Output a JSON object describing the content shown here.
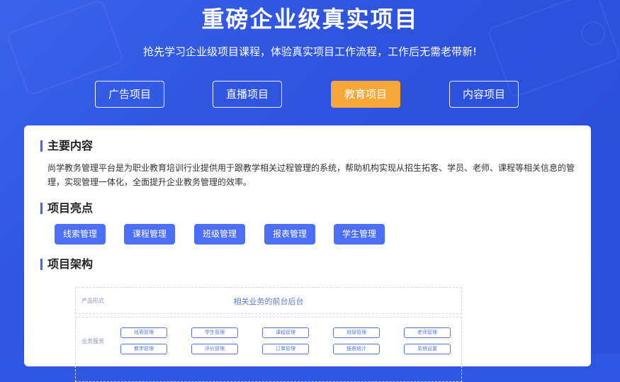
{
  "hero": {
    "title": "重磅企业级真实项目",
    "subtitle": "抢先学习企业级项目课程，体验真实项目工作流程，工作后无需老带新!"
  },
  "tabs": [
    {
      "label": "广告项目",
      "active": false
    },
    {
      "label": "直播项目",
      "active": false
    },
    {
      "label": "教育项目",
      "active": true
    },
    {
      "label": "内容项目",
      "active": false
    }
  ],
  "content": {
    "main_title": "主要内容",
    "main_desc": "尚学教务管理平台是为职业教育培训行业提供用于跟教学相关过程管理的系统，帮助机构实现从招生拓客、学员、老师、课程等相关信息的管理，实现管理一体化，全面提升企业教务管理的效率。",
    "highlights_title": "项目亮点",
    "highlights": [
      "线索管理",
      "课程管理",
      "班级管理",
      "报表管理",
      "学生管理"
    ],
    "architecture_title": "项目架构"
  },
  "architecture": {
    "row1_label": "产品形式",
    "row1_head": "相关业务的前台后台",
    "row2_label": "业务服务",
    "boxes_top": [
      "线索管理",
      "学生管理",
      "课程管理",
      "班级管理",
      "老师管理"
    ],
    "boxes_bottom": [
      "教学管理",
      "评价管理",
      "订单管理",
      "报表统计",
      "系统设置"
    ]
  },
  "colors": {
    "background": "#2f56e0",
    "active_tab": "#f7a738",
    "pill": "#4c6ef5",
    "accent_bar": "#3d6bf0"
  }
}
